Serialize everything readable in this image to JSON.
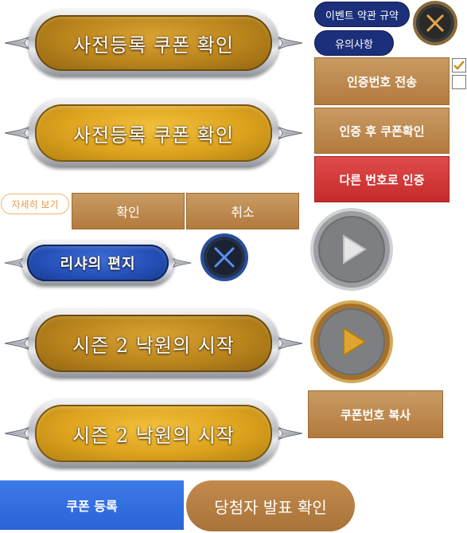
{
  "buttons": {
    "preregister_coupon_1": "사전등록 쿠폰 확인",
    "preregister_coupon_2": "사전등록 쿠폰 확인",
    "event_terms": "이벤트 약관 규약",
    "notice": "유의사항",
    "send_auth_code": "인증번호 전송",
    "confirm_coupon_after_auth": "인증 후 쿠폰확인",
    "auth_other_number": "다른 번호로 인증",
    "view_details": "자세히 보기",
    "confirm": "확인",
    "cancel": "취소",
    "lisha_letter": "리샤의 편지",
    "season2_1": "시즌 2 낙원의 시작",
    "season2_2": "시즌 2 낙원의 시작",
    "copy_coupon_code": "쿠폰번호 복사",
    "register_coupon": "쿠폰 등록",
    "check_winners": "당첨자 발표 확인"
  },
  "checkboxes": [
    {
      "checked": true
    },
    {
      "checked": false
    }
  ],
  "colors": {
    "gold": "#c9921f",
    "navy": "#1c2f7a",
    "brown": "#b37a3d",
    "red": "#d03a3a",
    "blue": "#2a63d6"
  }
}
